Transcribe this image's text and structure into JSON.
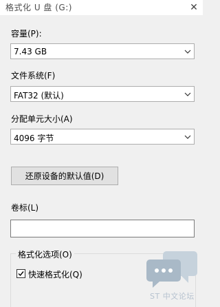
{
  "window": {
    "title": "格式化 U 盘 (G:)",
    "close_glyph": "✕"
  },
  "capacity": {
    "label": "容量(P):",
    "value": "7.43 GB"
  },
  "filesystem": {
    "label": "文件系统(F)",
    "value": "FAT32 (默认)"
  },
  "allocation": {
    "label": "分配单元大小(A)",
    "value": "4096 字节"
  },
  "restore_button": {
    "label": "还原设备的默认值(D)"
  },
  "volume": {
    "label": "卷标(L)",
    "value": ""
  },
  "format_options": {
    "title": "格式化选项(O)",
    "quick_format": {
      "label": "快速格式化(Q)",
      "checked": true
    }
  },
  "watermark": {
    "text": "ST 中文论坛",
    "icon": "chat-bubble-icon"
  }
}
